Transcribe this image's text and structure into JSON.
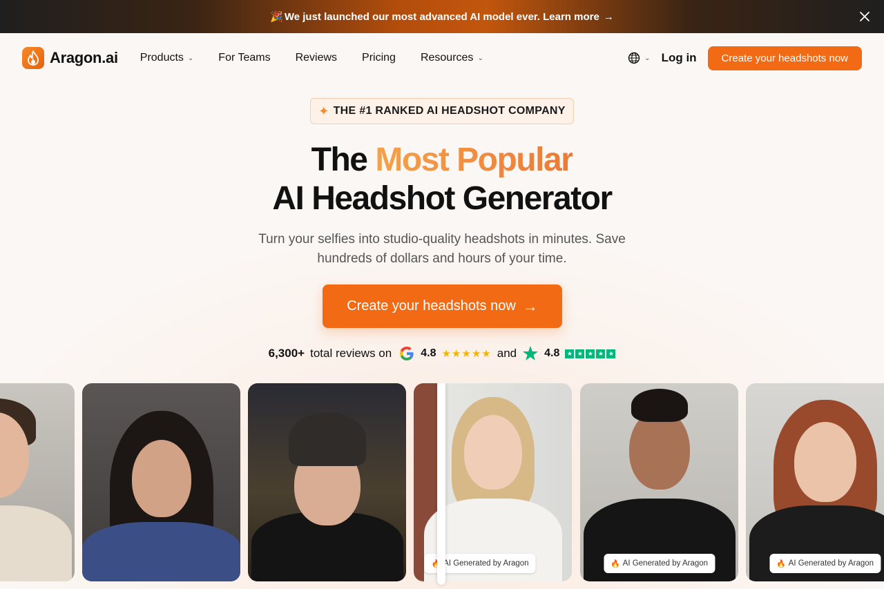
{
  "announcement": {
    "emoji": "🎉",
    "text": "We just launched our most advanced AI model ever. Learn more",
    "arrow": "→"
  },
  "header": {
    "logo_text": "Aragon.ai",
    "nav": [
      {
        "label": "Products",
        "has_dropdown": true
      },
      {
        "label": "For Teams",
        "has_dropdown": false
      },
      {
        "label": "Reviews",
        "has_dropdown": false
      },
      {
        "label": "Pricing",
        "has_dropdown": false
      },
      {
        "label": "Resources",
        "has_dropdown": true
      }
    ],
    "language_icon": "globe-icon",
    "login_label": "Log in",
    "cta_label": "Create your headshots now"
  },
  "hero": {
    "badge": "THE #1 RANKED AI HEADSHOT COMPANY",
    "title_prefix": "The ",
    "title_accent": "Most Popular",
    "title_line2": "AI Headshot Generator",
    "subtitle": "Turn your selfies into studio-quality headshots in minutes. Save hundreds of dollars and hours of your time.",
    "cta_label": "Create your headshots now",
    "cta_arrow": "→"
  },
  "reviews": {
    "count": "6,300+",
    "text": "total reviews on",
    "google_rating": "4.8",
    "and": "and",
    "trustpilot_rating": "4.8",
    "google_stars": "★★★★★",
    "trustpilot_stars": 5
  },
  "gallery": {
    "ai_label": "AI Generated by Aragon"
  },
  "colors": {
    "accent": "#f26a13",
    "trustpilot": "#00b67a",
    "star": "#f5b400"
  }
}
